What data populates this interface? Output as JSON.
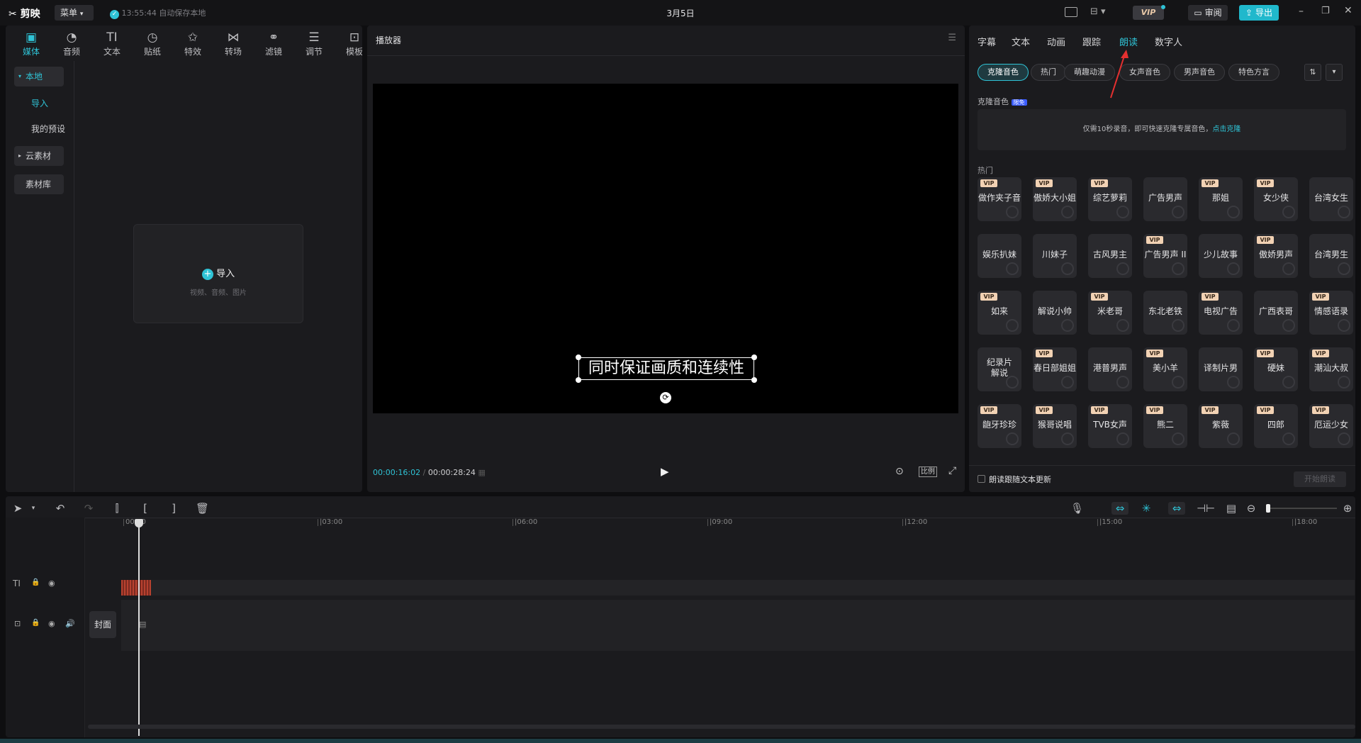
{
  "app": {
    "logo": "剪映",
    "menu_label": "菜单",
    "autosave_text": "13:55:44 自动保存本地",
    "project_title": "3月5日",
    "vip_label": "VIP",
    "review_label": "审阅",
    "export_label": "导出"
  },
  "media_toolbar": [
    {
      "label": "媒体",
      "icon": "media-icon",
      "glyph": "▣"
    },
    {
      "label": "音频",
      "icon": "audio-icon",
      "glyph": "◔"
    },
    {
      "label": "文本",
      "icon": "text-icon",
      "glyph": "TI"
    },
    {
      "label": "贴纸",
      "icon": "sticker-icon",
      "glyph": "◷"
    },
    {
      "label": "特效",
      "icon": "effects-icon",
      "glyph": "✩"
    },
    {
      "label": "转场",
      "icon": "transition-icon",
      "glyph": "⋈"
    },
    {
      "label": "滤镜",
      "icon": "filter-icon",
      "glyph": "⚭"
    },
    {
      "label": "调节",
      "icon": "adjust-icon",
      "glyph": "☰"
    },
    {
      "label": "模板",
      "icon": "template-icon",
      "glyph": "⊡"
    }
  ],
  "sidebar": {
    "local": "本地",
    "import": "导入",
    "presets": "我的预设",
    "cloud": "云素材",
    "library": "素材库"
  },
  "import_box": {
    "label": "导入",
    "hint": "视频、音频、图片"
  },
  "player": {
    "title": "播放器",
    "subtitle_text": "同时保证画质和连续性",
    "current_time": "00:00:16:02",
    "total_time": "00:00:28:24",
    "ratio_label": "比例"
  },
  "props": {
    "tabs": [
      "字幕",
      "文本",
      "动画",
      "跟踪",
      "朗读",
      "数字人"
    ],
    "active_tab": "朗读",
    "chips": [
      "克隆音色",
      "热门",
      "萌趣动漫",
      "女声音色",
      "男声音色",
      "特色方言"
    ],
    "clone_title": "克隆音色",
    "clone_badge": "限免",
    "clone_hint": "仅需10秒录音，即可快速克隆专属音色，",
    "clone_link": "点击克隆",
    "hot_title": "热门",
    "voices": [
      {
        "name": "做作夹子音",
        "vip": true
      },
      {
        "name": "傲娇大小姐",
        "vip": true
      },
      {
        "name": "综艺萝莉",
        "vip": true
      },
      {
        "name": "广告男声",
        "vip": false
      },
      {
        "name": "那姐",
        "vip": true
      },
      {
        "name": "女少侠",
        "vip": true
      },
      {
        "name": "台湾女生",
        "vip": false
      },
      {
        "name": "娱乐扒妹",
        "vip": false
      },
      {
        "name": "川妹子",
        "vip": false
      },
      {
        "name": "古风男主",
        "vip": false
      },
      {
        "name": "广告男声 II",
        "vip": true
      },
      {
        "name": "少儿故事",
        "vip": false
      },
      {
        "name": "傲娇男声",
        "vip": true
      },
      {
        "name": "台湾男生",
        "vip": false
      },
      {
        "name": "如来",
        "vip": true
      },
      {
        "name": "解说小帅",
        "vip": false
      },
      {
        "name": "米老哥",
        "vip": true
      },
      {
        "name": "东北老铁",
        "vip": false
      },
      {
        "name": "电视广告",
        "vip": true
      },
      {
        "name": "广西表哥",
        "vip": false
      },
      {
        "name": "情感语录",
        "vip": true
      },
      {
        "name": "纪录片解说",
        "vip": false
      },
      {
        "name": "春日部姐姐",
        "vip": true
      },
      {
        "name": "港普男声",
        "vip": false
      },
      {
        "name": "美小羊",
        "vip": true
      },
      {
        "name": "译制片男",
        "vip": false
      },
      {
        "name": "硬妹",
        "vip": true
      },
      {
        "name": "潮汕大叔",
        "vip": true
      },
      {
        "name": "龅牙珍珍",
        "vip": true
      },
      {
        "name": "猴哥说唱",
        "vip": true
      },
      {
        "name": "TVB女声",
        "vip": true
      },
      {
        "name": "熊二",
        "vip": true
      },
      {
        "name": "紫薇",
        "vip": true
      },
      {
        "name": "四郎",
        "vip": true
      },
      {
        "name": "厄运少女",
        "vip": true
      }
    ],
    "follow_text_label": "朗读跟随文本更新",
    "start_button": "开始朗读"
  },
  "timeline": {
    "ticks": [
      "00:00",
      "|03:00",
      "|06:00",
      "|09:00",
      "|12:00",
      "|15:00",
      "|18:00"
    ],
    "cover_label": "封面",
    "text_track_icon": "TI"
  },
  "colors": {
    "accent": "#2fc3d6",
    "vip": "#f2d2b4",
    "clip": "#b8412f"
  }
}
